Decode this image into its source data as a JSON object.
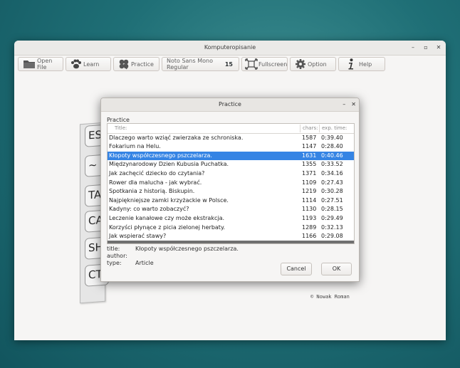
{
  "window": {
    "title": "Komputeropisanie",
    "controls": [
      "–",
      "▫",
      "✕"
    ]
  },
  "toolbar": {
    "open_file": "Open File",
    "learn": "Learn",
    "practice": "Practice",
    "font_name": "Noto Sans Mono Regular",
    "font_size": "15",
    "fullscreen": "Fullscreen",
    "option": "Option",
    "help": "Help"
  },
  "keyboard": {
    "keys": [
      "ESC",
      "~",
      "TA",
      "CA",
      "SH",
      "CT"
    ]
  },
  "copyright": "© Nowak Roman",
  "dialog": {
    "title": "Practice",
    "controls": [
      "–",
      "✕"
    ],
    "group_label": "Practice",
    "columns": {
      "title": "Title:",
      "chars": "chars:",
      "time": "exp. time:"
    },
    "rows": [
      {
        "title": "Dlaczego warto wziąć zwierzaka ze schroniska.",
        "chars": "1587",
        "time": "0:39.40"
      },
      {
        "title": "Fokarium na Helu.",
        "chars": "1147",
        "time": "0:28.40"
      },
      {
        "title": "Kłopoty współczesnego pszczelarza.",
        "chars": "1631",
        "time": "0:40.46"
      },
      {
        "title": "Międzynarodowy Dzien Kubusia Puchatka.",
        "chars": "1355",
        "time": "0:33.52"
      },
      {
        "title": "Jak zachęcić dziecko do czytania?",
        "chars": "1371",
        "time": "0:34.16"
      },
      {
        "title": "Rower dla malucha - jak wybrać.",
        "chars": "1109",
        "time": "0:27.43"
      },
      {
        "title": "Spotkania z historią. Biskupin.",
        "chars": "1219",
        "time": "0:30.28"
      },
      {
        "title": "Najpiękniejsze zamki krzyżackie w Polsce.",
        "chars": "1114",
        "time": "0:27.51"
      },
      {
        "title": "Kadyny: co warto zobaczyć?",
        "chars": "1130",
        "time": "0:28.15"
      },
      {
        "title": "Leczenie kanałowe czy może ekstrakcja.",
        "chars": "1193",
        "time": "0:29.49"
      },
      {
        "title": "Korzyści płynące z picia zielonej herbaty.",
        "chars": "1289",
        "time": "0:32.13"
      },
      {
        "title": "Jak wspierać stawy?",
        "chars": "1166",
        "time": "0:29.08"
      }
    ],
    "selected_index": 2,
    "meta": {
      "title_label": "title:",
      "title_value": "Kłopoty współczesnego pszczelarza.",
      "author_label": "author:",
      "author_value": "",
      "type_label": "type:",
      "type_value": "Article"
    },
    "cancel": "Cancel",
    "ok": "OK"
  },
  "colors": {
    "selection": "#3584e4",
    "desktop": "#1f6f76"
  }
}
